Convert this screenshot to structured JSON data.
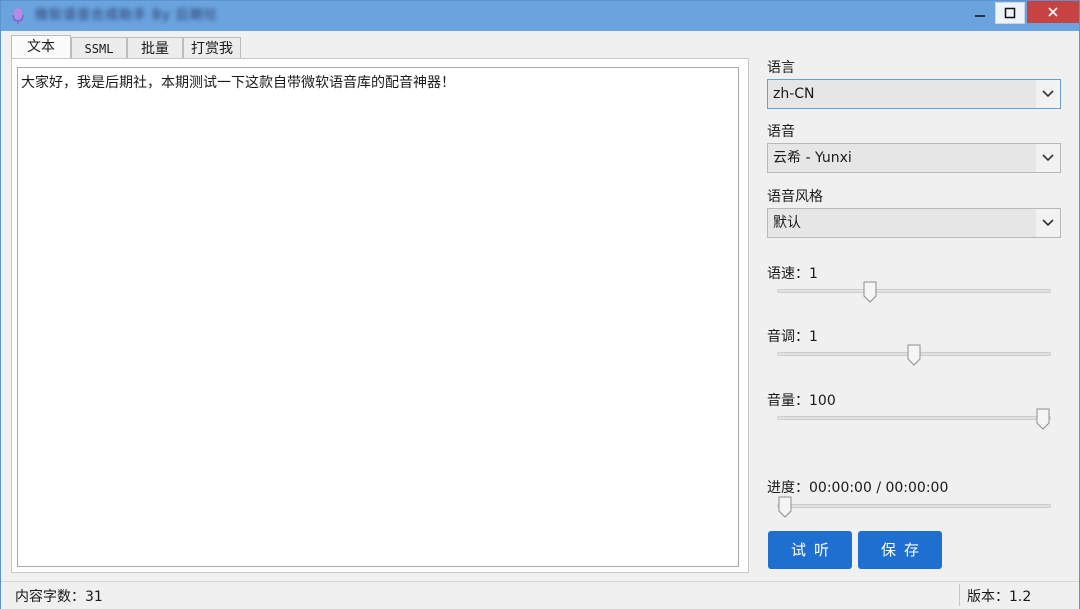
{
  "window": {
    "title": "微软语音合成助手 By 后期社",
    "controls": {
      "minimize": "─",
      "maximize": "□",
      "close": "✕"
    }
  },
  "tabs": [
    {
      "label": "文本",
      "active": true
    },
    {
      "label": "SSML",
      "active": false
    },
    {
      "label": "批量",
      "active": false
    },
    {
      "label": "打赏我",
      "active": false
    }
  ],
  "editor": {
    "text": "大家好，我是后期社，本期测试一下这款自带微软语音库的配音神器！"
  },
  "settings": {
    "language": {
      "label": "语言",
      "value": "zh-CN"
    },
    "voice": {
      "label": "语音",
      "value": "云希 - Yunxi"
    },
    "style": {
      "label": "语音风格",
      "value": "默认"
    },
    "rate": {
      "label": "语速：1",
      "level": 0.33
    },
    "pitch": {
      "label": "音调：1",
      "level": 0.5
    },
    "volume": {
      "label": "音量：100",
      "level": 1.0
    },
    "progress": {
      "label": "进度：00:00:00 / 00:00:00",
      "level": 0.0
    }
  },
  "buttons": {
    "listen": "试听",
    "save": "保存"
  },
  "status": {
    "char_count": "内容字数：31",
    "version": "版本：1.2"
  },
  "colors": {
    "titlebar": "#6aa3de",
    "action_button": "#1f6fd1",
    "close_button": "#c74242"
  }
}
